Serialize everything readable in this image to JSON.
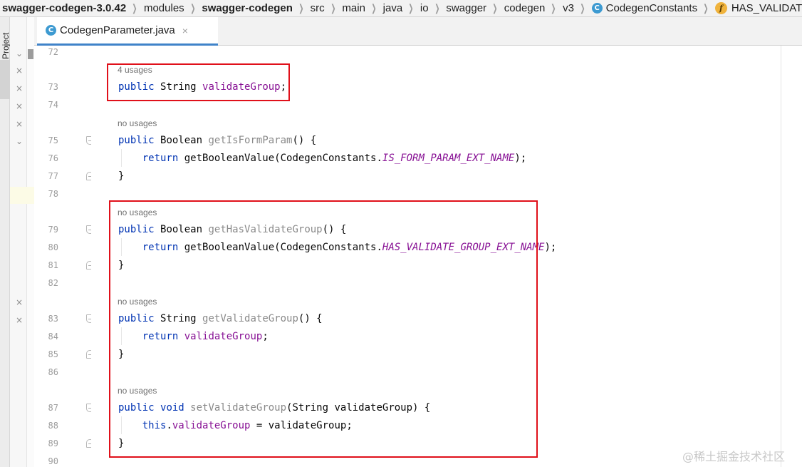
{
  "breadcrumb": {
    "items": [
      {
        "label": "swagger-codegen-3.0.42",
        "bold": true
      },
      {
        "label": "modules",
        "bold": false
      },
      {
        "label": "swagger-codegen",
        "bold": true
      },
      {
        "label": "src",
        "bold": false
      },
      {
        "label": "main",
        "bold": false
      },
      {
        "label": "java",
        "bold": false
      },
      {
        "label": "io",
        "bold": false
      },
      {
        "label": "swagger",
        "bold": false
      },
      {
        "label": "codegen",
        "bold": false
      },
      {
        "label": "v3",
        "bold": false
      }
    ],
    "class_item": {
      "badge": "C",
      "label": "CodegenConstants"
    },
    "field_item": {
      "badge": "f",
      "label": "HAS_VALIDATE_"
    }
  },
  "tool_window": {
    "label": "Project"
  },
  "editor_tab": {
    "badge": "C",
    "label": "CodegenParameter.java",
    "close": "×"
  },
  "gutter": {
    "line_numbers": [
      "72",
      "73",
      "74",
      "75",
      "76",
      "77",
      "78",
      "79",
      "80",
      "81",
      "82",
      "83",
      "84",
      "85",
      "86",
      "87",
      "88",
      "89",
      "90"
    ]
  },
  "code": {
    "hints": {
      "h73": "4 usages",
      "h75": "no usages",
      "h79": "no usages",
      "h83": "no usages",
      "h87": "no usages"
    },
    "l73": {
      "kw": "public",
      "type": "String",
      "field": "validateGroup",
      "semi": ";"
    },
    "l75": {
      "kw": "public",
      "type": "Boolean",
      "method": "getIsFormParam",
      "rest": "() {"
    },
    "l76": {
      "kw": "return",
      "call": "getBooleanValue(CodegenConstants.",
      "const": "IS_FORM_PARAM_EXT_NAME",
      "end": ");"
    },
    "l77": {
      "text": "}"
    },
    "l79": {
      "kw": "public",
      "type": "Boolean",
      "method": "getHasValidateGroup",
      "rest": "() {"
    },
    "l80": {
      "kw": "return",
      "call": "getBooleanValue(CodegenConstants.",
      "const": "HAS_VALIDATE_GROUP_EXT_NAME",
      "end": ");"
    },
    "l81": {
      "text": "}"
    },
    "l83": {
      "kw": "public",
      "type": "String",
      "method": "getValidateGroup",
      "rest": "() {"
    },
    "l84": {
      "kw": "return",
      "field": "validateGroup",
      "end": ";"
    },
    "l85": {
      "text": "}"
    },
    "l87": {
      "kw": "public",
      "kw2": "void",
      "method": "setValidateGroup",
      "rest": "(String validateGroup) {"
    },
    "l88": {
      "kw": "this",
      "dot": ".",
      "field": "validateGroup",
      "rest": " = validateGroup;"
    },
    "l89": {
      "text": "}"
    }
  },
  "watermark": "@稀土掘金技术社区",
  "colors": {
    "keyword": "#0033b3",
    "field": "#871094",
    "hint": "#717171",
    "annotation_box": "#e0101a",
    "tab_accent": "#4083c9"
  }
}
